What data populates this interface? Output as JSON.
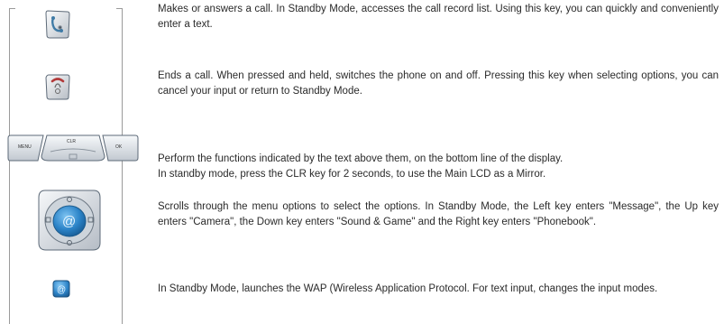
{
  "keys": [
    {
      "icon": "call-send-key-icon",
      "lines": [
        "Makes or answers a call. In Standby Mode, accesses the call record list. Using this key, you can quickly and conveniently enter a text."
      ]
    },
    {
      "icon": "end-power-key-icon",
      "lines": [
        "Ends a call. When pressed and held, switches the phone on and off. Pressing this key when selecting options, you can cancel your input or return to Standby Mode."
      ]
    },
    {
      "icon": "soft-keys-icon",
      "labels": [
        "MENU",
        "CLR",
        "OK"
      ],
      "lines": [
        "Perform the functions indicated by the text above them, on the bottom line of the display.",
        "In standby mode, press the CLR key for 2 seconds, to use the Main LCD as a Mirror."
      ]
    },
    {
      "icon": "navigation-keys-icon",
      "lines": [
        "Scrolls through the menu options to select the options. In Standby Mode, the Left key enters \"Message\", the Up key enters \"Camera\", the Down key enters \"Sound & Game\" and the Right key enters \"Phonebook\"."
      ]
    },
    {
      "icon": "wap-key-icon",
      "lines": [
        "In Standby Mode, launches the WAP (Wireless Application Protocol. For text input, changes the input modes."
      ]
    }
  ]
}
